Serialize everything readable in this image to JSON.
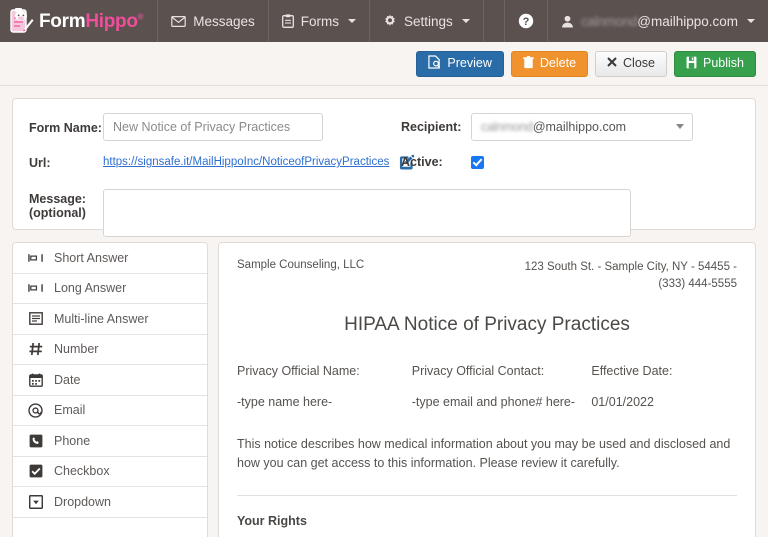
{
  "navbar": {
    "brand": {
      "first": "Form",
      "second": "Hippo",
      "reg": "®",
      "logo_icon": "clipboard-hippo-logo-icon"
    },
    "items": [
      {
        "label": "Messages",
        "icon": "envelope-icon",
        "caret": false
      },
      {
        "label": "Forms",
        "icon": "clipboard-icon",
        "caret": true
      },
      {
        "label": "Settings",
        "icon": "gear-icon",
        "caret": true
      }
    ],
    "help_icon": "question-circle-icon",
    "account": {
      "label": "@mailhippo.com",
      "redacted_user": "calnmond",
      "icon": "user-icon",
      "caret": true
    }
  },
  "actionbar": {
    "preview": {
      "label": "Preview",
      "icon": "file-search-icon",
      "color": "#2a6ca8"
    },
    "delete": {
      "label": "Delete",
      "icon": "trash-icon",
      "color": "#f0932f"
    },
    "close": {
      "label": "Close",
      "icon": "x-icon",
      "color": "#efefef"
    },
    "publish": {
      "label": "Publish",
      "icon": "save-icon",
      "color": "#36a04c"
    }
  },
  "form": {
    "form_name_label": "Form Name:",
    "form_name_value": "New Notice of Privacy Practices",
    "form_name_placeholder": "New Notice of Privacy Practices",
    "url_label": "Url:",
    "url_value": "https://signsafe.it/MailHippoInc/NoticeofPrivacyPractices",
    "edit_icon": "pencil-square-icon",
    "message_label": "Message:",
    "message_sublabel": "(optional)",
    "message_value": "",
    "recipient_label": "Recipient:",
    "recipient_value": "@mailhippo.com",
    "recipient_redacted_user": "calnmond",
    "active_label": "Active:",
    "active_checked": true
  },
  "fieldlist": [
    {
      "label": "Short Answer",
      "icon": "short-answer-icon"
    },
    {
      "label": "Long Answer",
      "icon": "long-answer-icon"
    },
    {
      "label": "Multi-line Answer",
      "icon": "multiline-answer-icon"
    },
    {
      "label": "Number",
      "icon": "hash-icon"
    },
    {
      "label": "Date",
      "icon": "calendar-icon"
    },
    {
      "label": "Email",
      "icon": "at-icon"
    },
    {
      "label": "Phone",
      "icon": "phone-icon"
    },
    {
      "label": "Checkbox",
      "icon": "checkbox-icon"
    },
    {
      "label": "Dropdown",
      "icon": "dropdown-icon"
    }
  ],
  "document": {
    "org": "Sample Counseling, LLC",
    "address": "123 South St. - Sample City, NY - 54455 - (333) 444-5555",
    "title": "HIPAA Notice of Privacy Practices",
    "col1_header": "Privacy Official Name:",
    "col1_value": "-type name here-",
    "col2_header": "Privacy Official Contact:",
    "col2_value": "-type email and phone# here-",
    "col3_header": "Effective Date:",
    "col3_value": "01/01/2022",
    "paragraph": "This notice describes how medical information about you may be used and disclosed and how you can get access to this information. Please review it carefully.",
    "section_heading": "Your Rights"
  }
}
